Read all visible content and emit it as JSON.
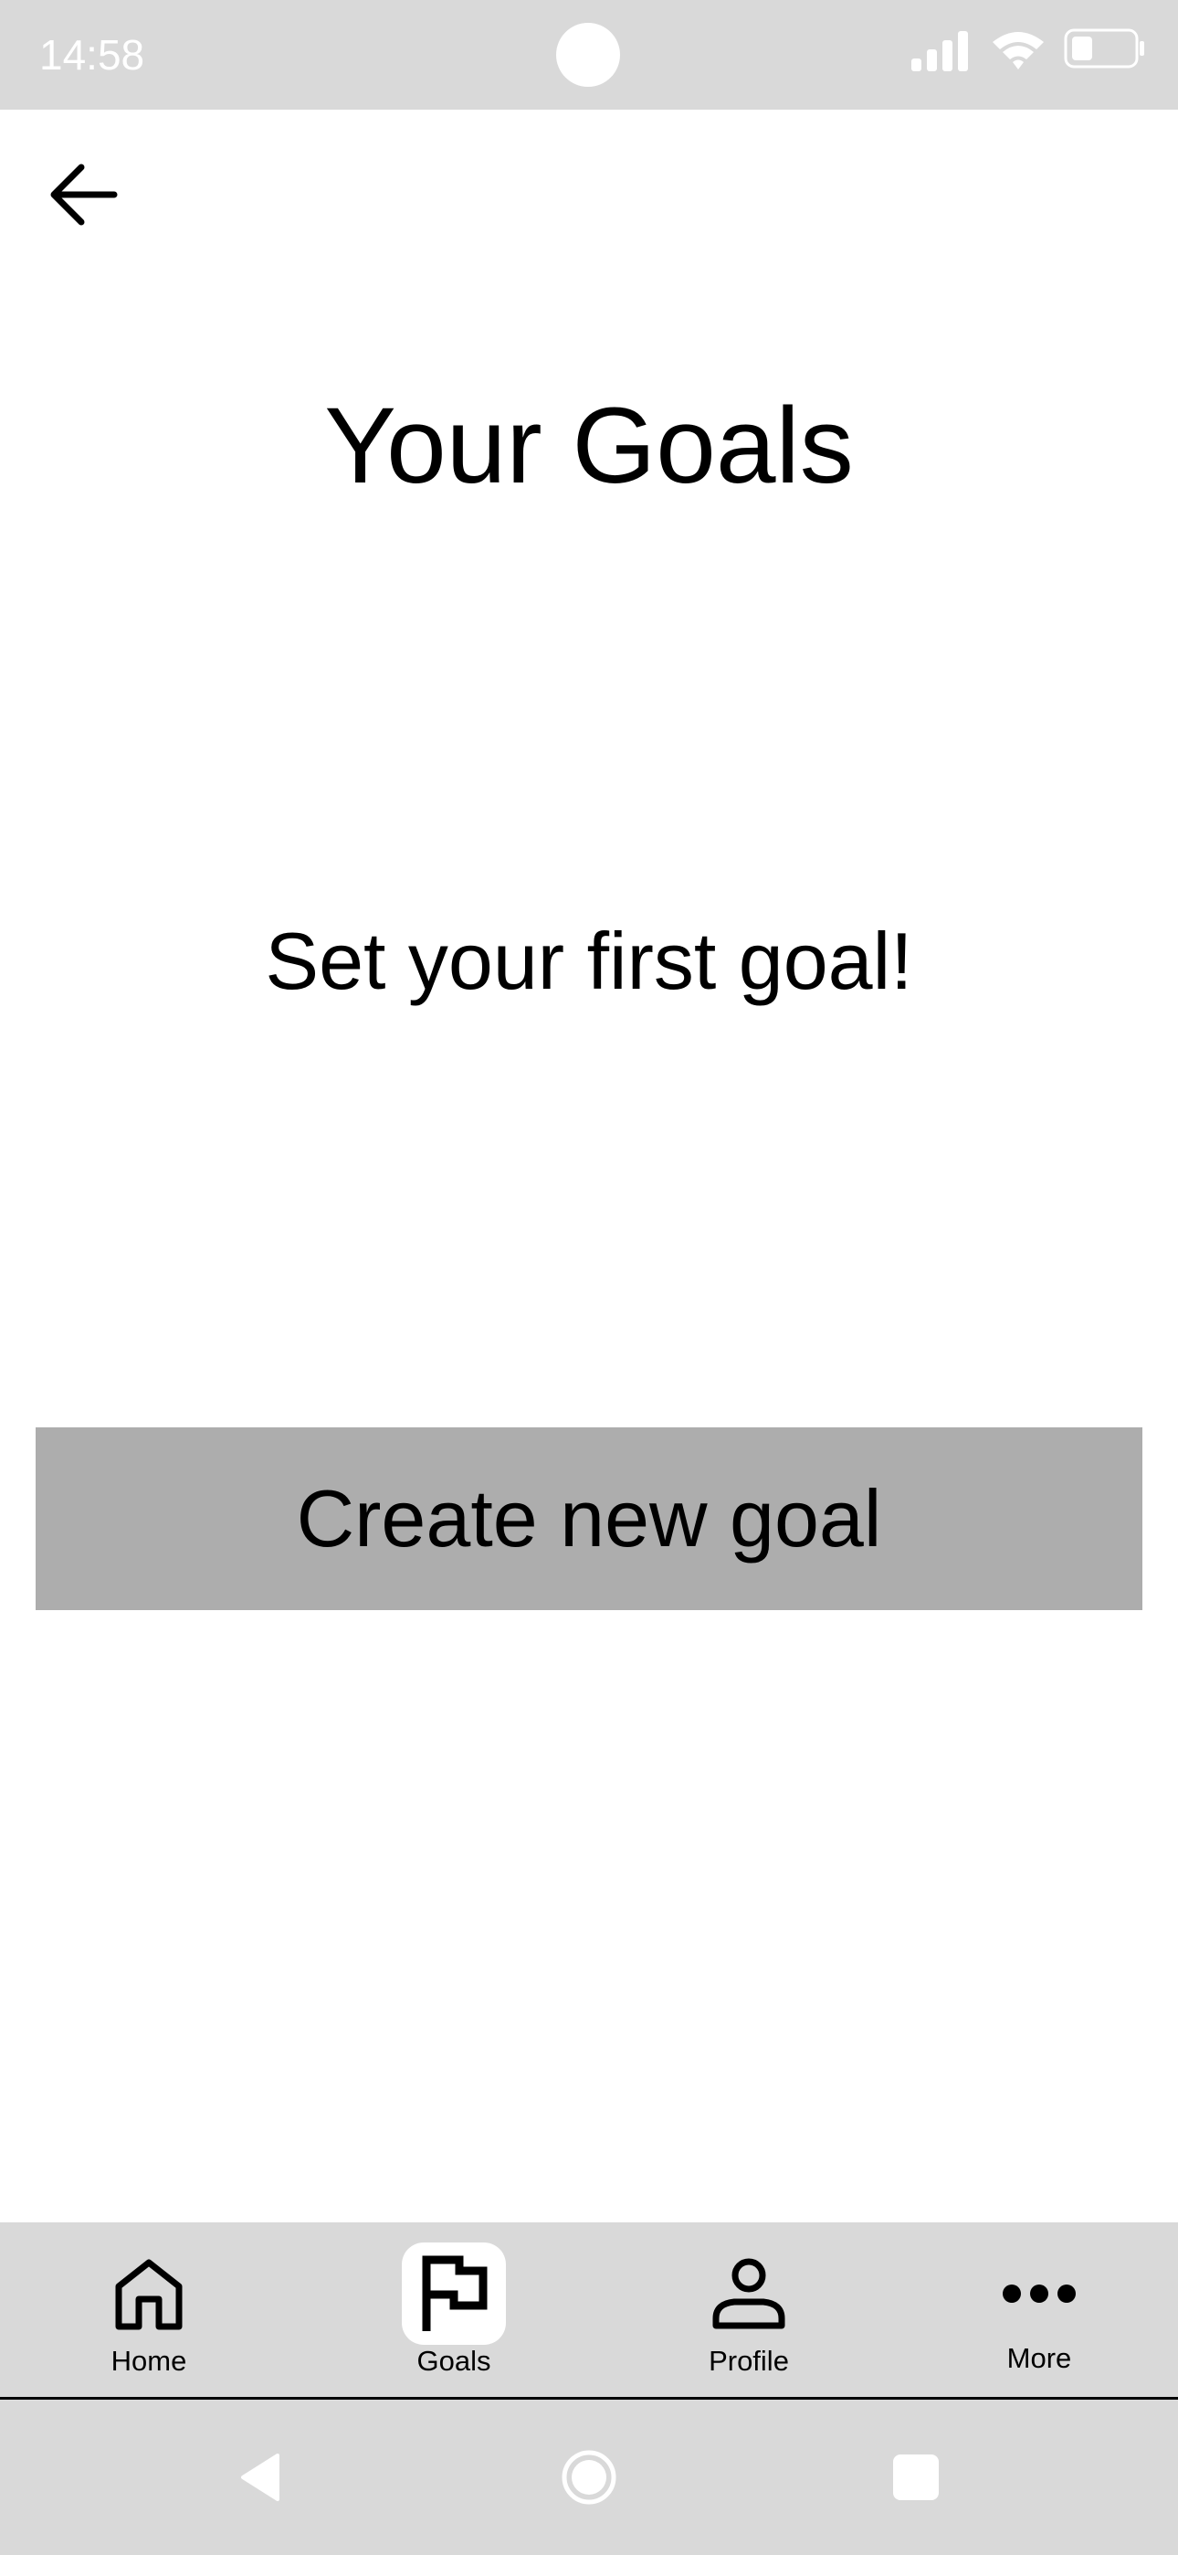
{
  "status_bar": {
    "time": "14:58",
    "icons": [
      "signal-icon",
      "wifi-icon",
      "battery-icon"
    ]
  },
  "header": {
    "back_icon": "arrow-left-icon",
    "title": "Your Goals"
  },
  "main": {
    "empty_message": "Set your first goal!",
    "create_button_label": "Create new goal",
    "create_button_color": "#adadad"
  },
  "bottom_nav": {
    "active": "Goals",
    "items": [
      {
        "label": "Home",
        "icon": "home-icon"
      },
      {
        "label": "Goals",
        "icon": "flag-icon"
      },
      {
        "label": "Profile",
        "icon": "person-icon"
      },
      {
        "label": "More",
        "icon": "more-dots-icon"
      }
    ]
  },
  "system_nav": {
    "icons": [
      "back-triangle-icon",
      "home-circle-icon",
      "recents-square-icon"
    ]
  },
  "colors": {
    "bar_background": "#d9d9d9",
    "page_background": "#ffffff",
    "text": "#000000"
  }
}
